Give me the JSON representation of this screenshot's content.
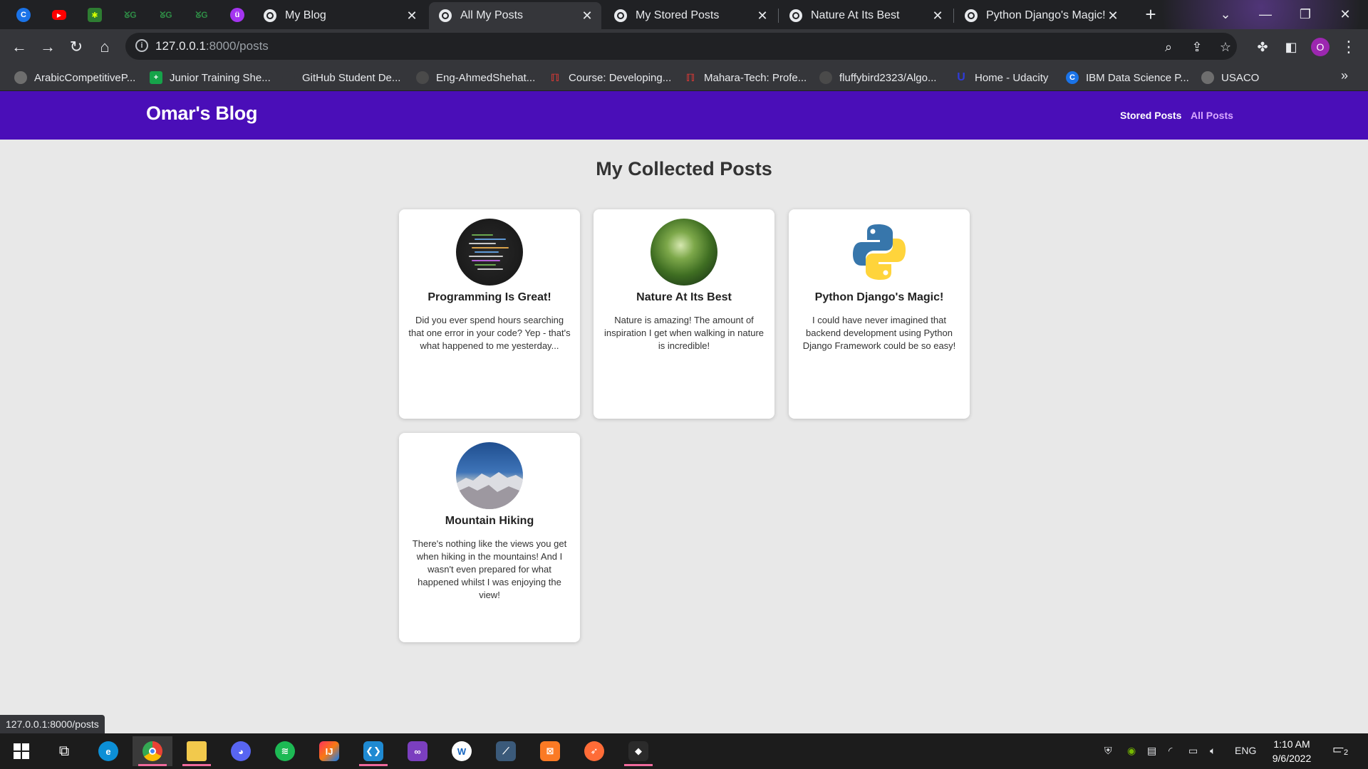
{
  "browser": {
    "tabs": [
      {
        "label": "My Blog",
        "active": false
      },
      {
        "label": "All My Posts",
        "active": true
      },
      {
        "label": "My Stored Posts",
        "active": false
      },
      {
        "label": "Nature At Its Best",
        "active": false
      },
      {
        "label": "Python Django's Magic!",
        "active": false
      }
    ],
    "pinned_tabs": [
      "c-icon",
      "youtube-icon",
      "puzzle-icon",
      "geeksforgeeks-icon",
      "geeksforgeeks-icon",
      "geeksforgeeks-icon",
      "udemy-icon"
    ],
    "url_host": "127.0.0.1",
    "url_path": ":8000/posts",
    "profile_initial": "O",
    "bookmarks": [
      {
        "label": "ArabicCompetitiveP...",
        "icon": "github-icon",
        "color": "#6e6e6e"
      },
      {
        "label": "Junior Training She...",
        "icon": "sheets-icon",
        "color": "#16a34a"
      },
      {
        "label": "GitHub Student De...",
        "icon": "github-icon",
        "color": "#35363a"
      },
      {
        "label": "Eng-AhmedShehat...",
        "icon": "github-icon",
        "color": "#6e6e6e"
      },
      {
        "label": "Course: Developing...",
        "icon": "mahara-icon",
        "color": "#e53935"
      },
      {
        "label": "Mahara-Tech: Profe...",
        "icon": "mahara-icon",
        "color": "#e53935"
      },
      {
        "label": "fluffybird2323/Algo...",
        "icon": "github-icon",
        "color": "#6e6e6e"
      },
      {
        "label": "Home - Udacity",
        "icon": "udacity-icon",
        "color": "#2f3bd8"
      },
      {
        "label": "IBM Data Science P...",
        "icon": "coursera-icon",
        "color": "#1a73e8"
      },
      {
        "label": "USACO",
        "icon": "globe-icon",
        "color": "#6e6e6e"
      }
    ],
    "status_url": "127.0.0.1:8000/posts"
  },
  "site": {
    "title": "Omar's Blog",
    "nav": {
      "stored": "Stored Posts",
      "all": "All Posts"
    },
    "heading": "My Collected Posts",
    "posts": [
      {
        "title": "Programming Is Great!",
        "excerpt": "Did you ever spend hours searching that one error in your code? Yep - that's what happened to me yesterday...",
        "image": "code-image"
      },
      {
        "title": "Nature At Its Best",
        "excerpt": "Nature is amazing! The amount of inspiration I get when walking in nature is incredible!",
        "image": "forest-image"
      },
      {
        "title": "Python Django's Magic!",
        "excerpt": "I could have never imagined that backend development using Python Django Framework could be so easy!",
        "image": "python-logo"
      },
      {
        "title": "Mountain Hiking",
        "excerpt": "There's nothing like the views you get when hiking in the mountains! And I wasn't even prepared for what happened whilst I was enjoying the view!",
        "image": "mountain-image"
      }
    ]
  },
  "taskbar": {
    "language": "ENG",
    "time": "1:10 AM",
    "date": "9/6/2022",
    "notification_count": "2"
  },
  "colors": {
    "header": "#4a0eb8",
    "nav_active": "#d8a8ff",
    "page_bg": "#e8e8e8"
  }
}
